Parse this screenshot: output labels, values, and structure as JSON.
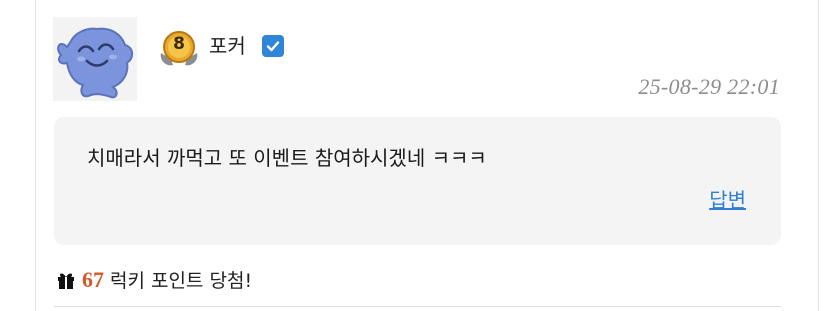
{
  "comment": {
    "author": "포커",
    "level": "8",
    "timestamp": "25-08-29 22:01",
    "text": "치매라서 까먹고 또 이벤트 참여하시겠네 ㅋㅋㅋ",
    "reply_label": "답변",
    "avatar_icon": "blue-ghost-avatar",
    "badge_icon": "gold-level-medal-icon",
    "verified_icon": "verified-check-icon"
  },
  "lucky_point": {
    "icon": "gift-icon",
    "amount": "67",
    "label": "럭키 포인트 당첨!"
  },
  "colors": {
    "timestamp": "#8d8d8d",
    "reply_link": "#2f7fd3",
    "lucky_amount": "#d35a28",
    "verified": "#2f86d9",
    "bubble": "#f4f4f4"
  }
}
